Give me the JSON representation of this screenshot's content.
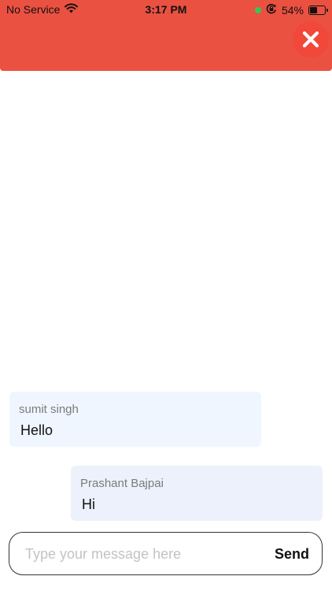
{
  "status_bar": {
    "carrier": "No Service",
    "time": "3:17 PM",
    "battery": "54%",
    "battery_level": 0.54,
    "wifi_icon": "wifi-icon",
    "orientation_lock_icon": "orientation-lock-icon",
    "mic_indicator_color": "#34c759"
  },
  "header": {
    "background_color": "#ea5141",
    "close_icon": "close-icon"
  },
  "messages": [
    {
      "sender": "sumit singh",
      "text": "Hello"
    },
    {
      "sender": "Prashant Bajpai",
      "text": "Hi"
    }
  ],
  "composer": {
    "placeholder": "Type your message here",
    "value": "",
    "send_label": "Send"
  }
}
